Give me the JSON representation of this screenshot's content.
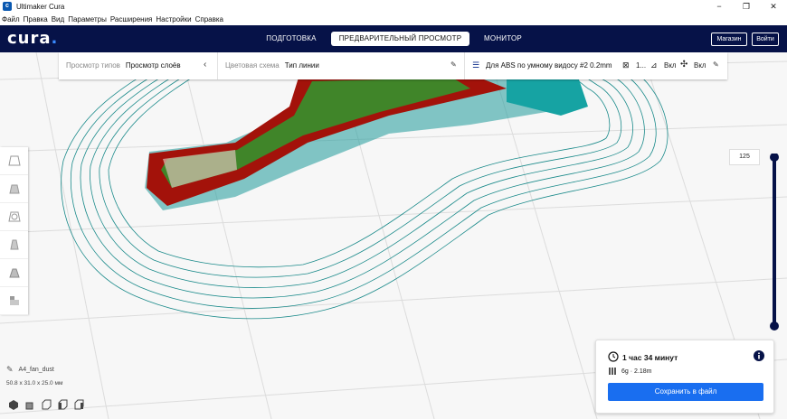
{
  "window": {
    "title": "Ultimaker Cura",
    "minimize": "−",
    "maximize": "❐",
    "close": "✕"
  },
  "menu": [
    "Файл",
    "Правка",
    "Вид",
    "Параметры",
    "Расширения",
    "Настройки",
    "Справка"
  ],
  "header": {
    "logo": "cura",
    "tabs": [
      {
        "label": "ПОДГОТОВКА",
        "active": false
      },
      {
        "label": "ПРЕДВАРИТЕЛЬНЫЙ ПРОСМОТР",
        "active": true
      },
      {
        "label": "МОНИТОР",
        "active": false
      }
    ],
    "marketplace": "Магазин",
    "signin": "Войти"
  },
  "view_bar": {
    "view_type_label": "Просмотр типов",
    "view_type_value": "Просмотр слоёв",
    "color_scheme_label": "Цветовая схема",
    "color_scheme_value": "Тип линии",
    "profile": "Для ABS по умному видосу #2 0.2mm",
    "infill": "1...",
    "support": "Вкл",
    "adhesion": "Вкл"
  },
  "layer_slider": {
    "current_layer": "125",
    "position_fraction": 1.0
  },
  "object": {
    "name": "A4_fan_dust",
    "dimensions": "50.8 x 31.0 x 25.0 мм"
  },
  "print_info": {
    "time": "1 час 34 минут",
    "material": "6g · 2.18m",
    "save_button": "Сохранить в файл"
  },
  "colors": {
    "header": "#061248",
    "accent": "#196ef0",
    "skirt": "#1a8a8a",
    "wall_outer": "#b0120a",
    "wall_inner": "#2f9a2f",
    "support": "#16a3a3"
  }
}
